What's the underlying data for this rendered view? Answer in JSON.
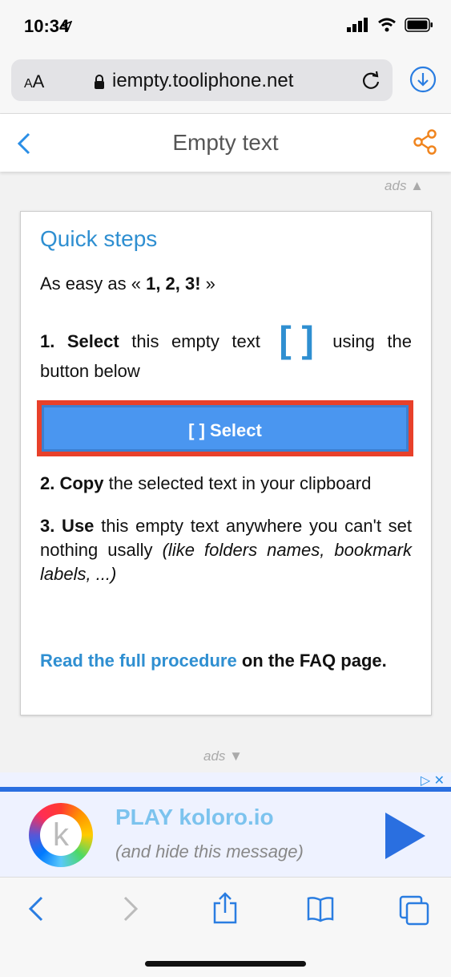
{
  "status": {
    "time": "10:34"
  },
  "browser": {
    "aa_label": "AA",
    "host": "iempty.tooliphone.net"
  },
  "header": {
    "title": "Empty text"
  },
  "ads_top": "ads ▲",
  "ads_bottom": "ads ▼",
  "card": {
    "heading": "Quick steps",
    "intro_prefix": "As easy as « ",
    "intro_bold": "1, 2, 3!",
    "intro_suffix": " »",
    "step1_num": "1. Select",
    "step1_text_a": " this empty text ",
    "step1_bracket": "[   ]",
    "step1_text_b": " using the button below",
    "select_button": "[ ] Select",
    "step2_num": "2. Copy",
    "step2_text": " the selected text in your clipboard",
    "step3_num": "3. Use",
    "step3_text": " this empty text anywhere you can't set nothing usally ",
    "step3_italic": "(like folders names, bookmark labels, ...)",
    "faq_link": "Read the full procedure",
    "faq_suffix": " on the FAQ page."
  },
  "banner": {
    "adchoice": "▷ ✕",
    "logo_letter": "k",
    "title": "PLAY koloro.io",
    "subtitle": "(and hide this message)"
  },
  "colors": {
    "accent": "#2f8fd1",
    "button": "#4a96f0",
    "highlight": "#e8402a",
    "share": "#f0851f"
  }
}
